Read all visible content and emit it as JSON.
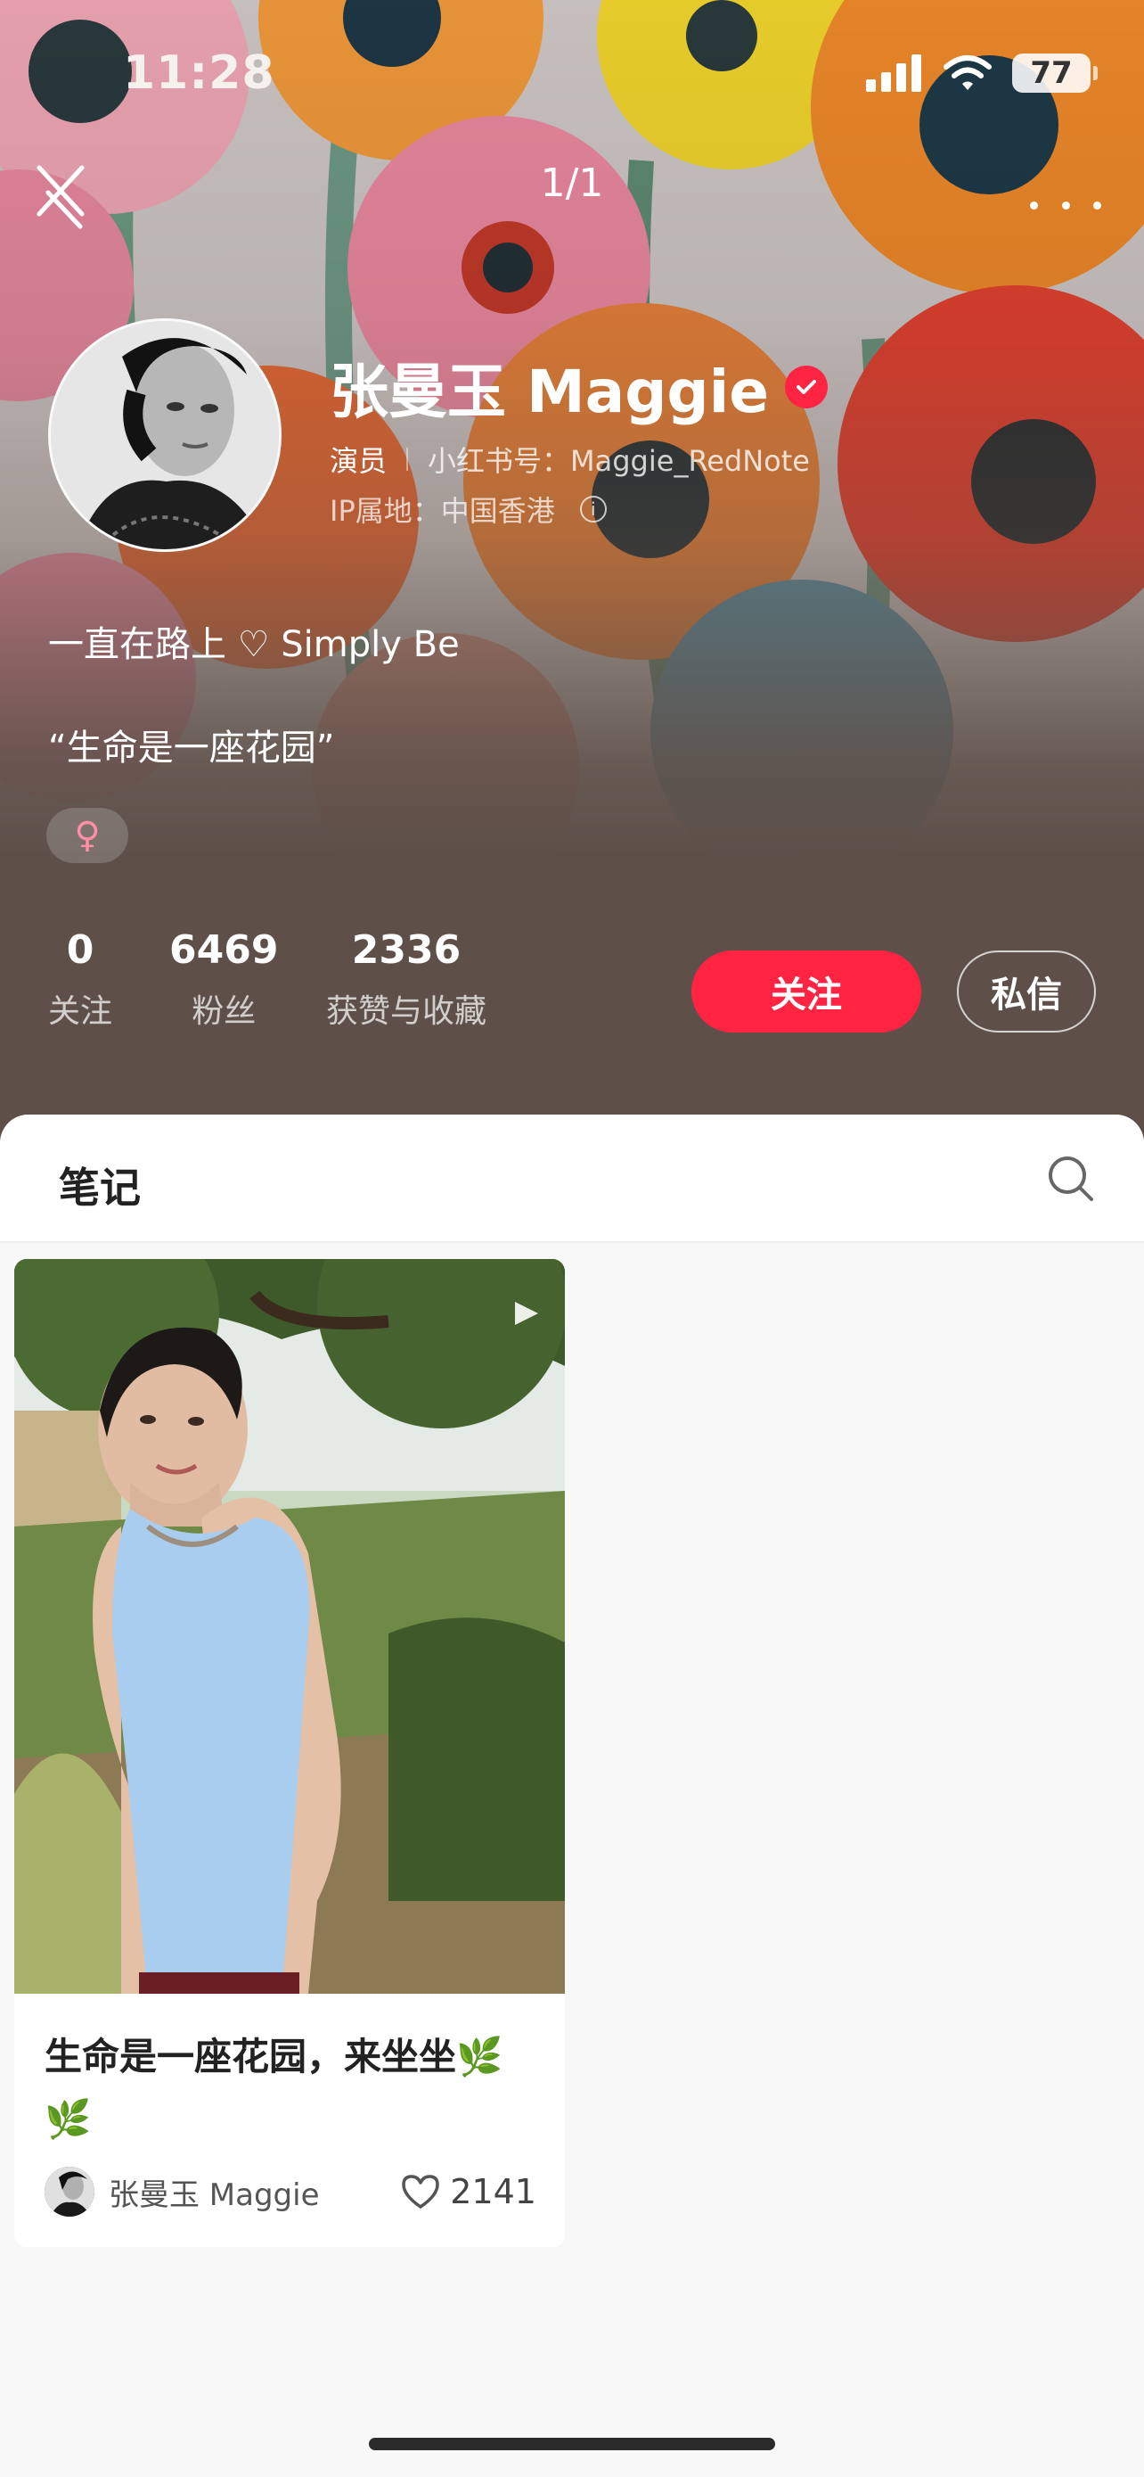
{
  "status_bar": {
    "time": "11:28",
    "battery": "77"
  },
  "nav": {
    "page_counter": "1/1"
  },
  "profile": {
    "name": "张曼玉 Maggie",
    "role": "演员",
    "red_id": "小红书号：Maggie_RedNote",
    "ip_location": "IP属地：中国香港",
    "bio_line1": "一直在路上 ♡ Simply Be",
    "bio_line2": "“生命是一座花园”",
    "gender_symbol": "♀"
  },
  "stats": {
    "following": {
      "value": "0",
      "label": "关注"
    },
    "fans": {
      "value": "6469",
      "label": "粉丝"
    },
    "likes": {
      "value": "2336",
      "label": "获赞与收藏"
    }
  },
  "actions": {
    "follow_label": "关注",
    "message_label": "私信"
  },
  "tabs": {
    "notes_label": "笔记"
  },
  "notes": [
    {
      "title": "生命是一座花园，来坐坐🌿🌿",
      "author": "张曼玉 Maggie",
      "likes": "2141",
      "type": "video"
    }
  ],
  "colors": {
    "accent": "#ff2442",
    "header_bg": "#5e5049"
  },
  "icons": [
    "close-icon",
    "more-icon",
    "verified-icon",
    "info-icon",
    "search-icon",
    "video-icon",
    "heart-icon"
  ]
}
